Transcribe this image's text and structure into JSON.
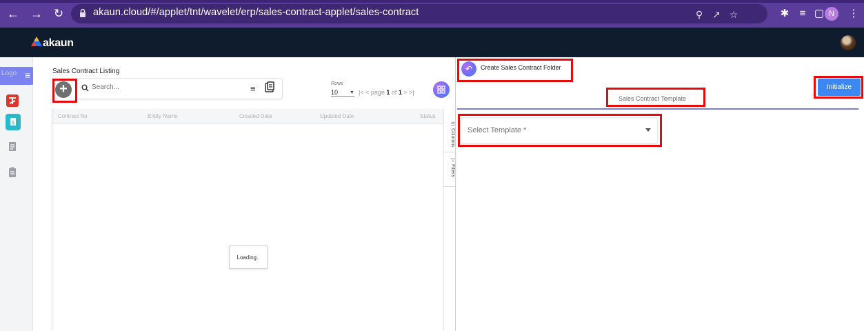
{
  "browser": {
    "url": "akaun.cloud/#/applet/tnt/wavelet/erp/sales-contract-applet/sales-contract",
    "profile_initial": "N"
  },
  "app": {
    "brand": "akaun"
  },
  "rail": {
    "pill_text": "Logo"
  },
  "listing": {
    "title": "Sales Contract Listing",
    "search_placeholder": "Search...",
    "rows_label": "Rows",
    "rows_value": "10",
    "pager_prefix": "|< < page ",
    "pager_page": "1",
    "pager_of": " of ",
    "pager_total": "1",
    "pager_suffix": " > >|",
    "columns": [
      "Contract No",
      "Entity Name",
      "Created Date",
      "Updated Date",
      "Status"
    ],
    "side_tabs": [
      "Columns",
      "Filters"
    ],
    "loading_text": "Loading.."
  },
  "detail": {
    "title": "Create Sales Contract Folder",
    "initialize_label": "Initialize",
    "tab_label": "Sales Contract Template",
    "select_placeholder": "Select Template *"
  },
  "colors": {
    "browser_bar": "#5a3d9a",
    "app_header": "#0f1c2e",
    "accent": "#3d88f0",
    "highlight": "#e20c0c"
  }
}
